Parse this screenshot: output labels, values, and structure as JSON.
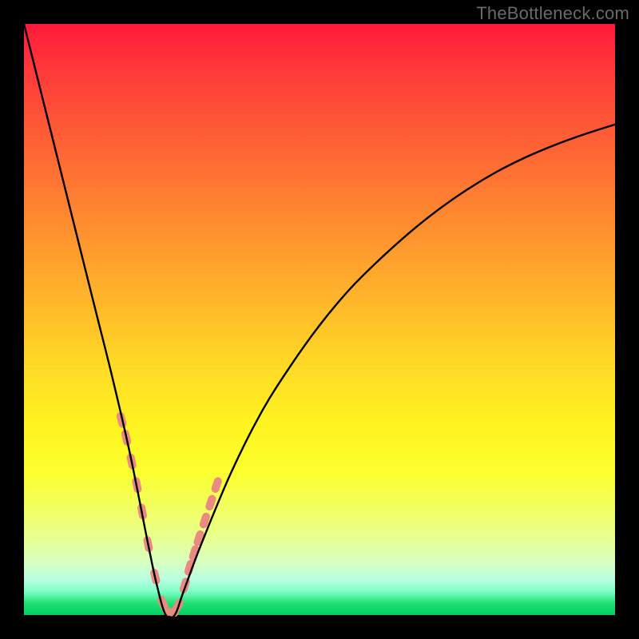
{
  "watermark": "TheBottleneck.com",
  "colors": {
    "marker": "#e98b80",
    "curve": "#000000"
  },
  "chart_data": {
    "type": "line",
    "title": "",
    "xlabel": "",
    "ylabel": "",
    "xlim": [
      0,
      100
    ],
    "ylim": [
      0,
      100
    ],
    "grid": false,
    "series": [
      {
        "name": "bottleneck-curve",
        "x_comment": "x runs 0..100 across plot width; y is bottleneck % (0 at optimum)",
        "x": [
          0,
          3,
          6,
          9,
          12,
          15,
          18,
          21,
          22.5,
          24,
          25.5,
          27,
          30,
          35,
          40,
          45,
          50,
          55,
          60,
          65,
          70,
          75,
          80,
          85,
          90,
          95,
          100
        ],
        "y": [
          100,
          88,
          76,
          64,
          52,
          40,
          27,
          12,
          5,
          0,
          0,
          4,
          12,
          24,
          34,
          42,
          49,
          55,
          60,
          64.5,
          68.5,
          72,
          75,
          77.5,
          79.6,
          81.4,
          83
        ]
      }
    ],
    "markers": {
      "name": "highlighted-points",
      "x": [
        16.5,
        17.3,
        18.2,
        19.1,
        20.0,
        21.0,
        22.2,
        23.5,
        24.8,
        26.0,
        27.2,
        28.0,
        28.8,
        29.6,
        30.6,
        31.6,
        32.6
      ],
      "y": [
        33,
        30,
        26,
        22,
        17.5,
        12,
        6.5,
        2,
        0.5,
        1.5,
        5,
        8,
        10.5,
        13,
        16,
        19,
        22
      ]
    }
  }
}
